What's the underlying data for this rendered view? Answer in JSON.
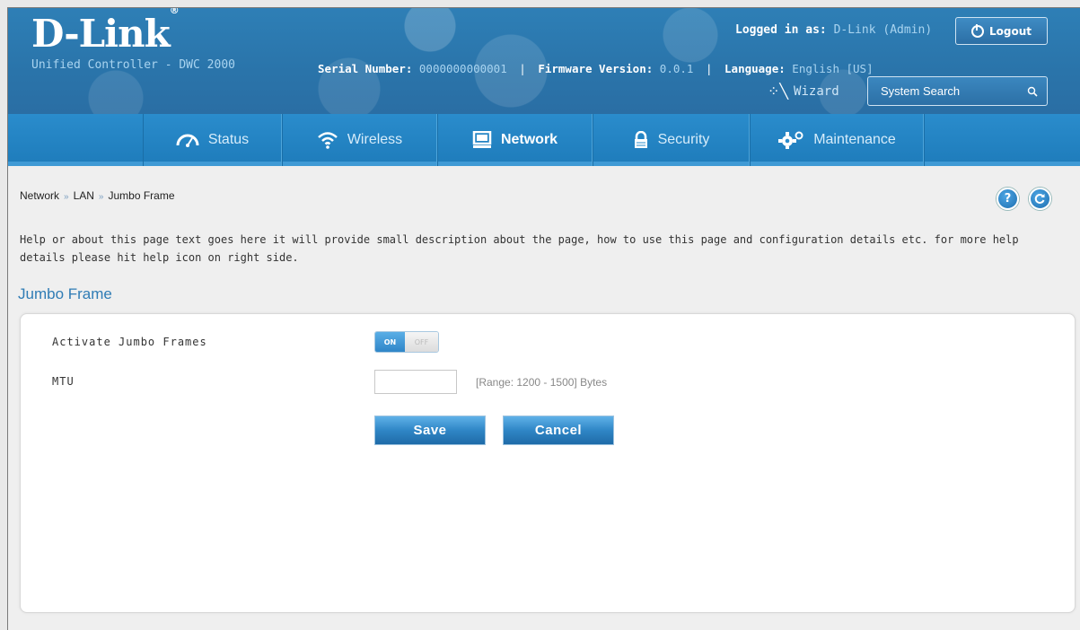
{
  "brand": {
    "logo": "D-Link",
    "logo_mark": "®",
    "subtitle": "Unified Controller - DWC 2000"
  },
  "session": {
    "logged_in_label": "Logged in as:",
    "user": "D-Link (Admin)",
    "logout_label": "Logout"
  },
  "device": {
    "serial_label": "Serial Number:",
    "serial_value": "0000000000001",
    "firmware_label": "Firmware Version:",
    "firmware_value": "0.0.1",
    "language_label": "Language:",
    "language_value": "English [US]"
  },
  "wizard_label": "Wizard",
  "search": {
    "placeholder": "System Search"
  },
  "nav": {
    "items": [
      {
        "label": "Status",
        "icon": "gauge-icon"
      },
      {
        "label": "Wireless",
        "icon": "wifi-icon"
      },
      {
        "label": "Network",
        "icon": "monitor-icon",
        "active": true
      },
      {
        "label": "Security",
        "icon": "lock-icon"
      },
      {
        "label": "Maintenance",
        "icon": "gears-icon"
      }
    ]
  },
  "breadcrumb": {
    "items": [
      "Network",
      "LAN",
      "Jumbo Frame"
    ],
    "separator": "»"
  },
  "help_icon_glyph": "?",
  "description": "Help or about this page text goes here  it will provide small description about the page, how to use this page and configuration details etc. for more help details please hit help icon on right side.",
  "section_title": "Jumbo Frame",
  "form": {
    "activate_label": "Activate Jumbo Frames",
    "toggle_on": "ON",
    "toggle_off": "OFF",
    "mtu_label": "MTU",
    "mtu_value": "",
    "mtu_range": "[Range: 1200 - 1500] Bytes",
    "save_label": "Save",
    "cancel_label": "Cancel"
  },
  "colors": {
    "header_blue": "#2a74aa",
    "nav_blue": "#1f7dbc",
    "accent": "#2f7cb5"
  }
}
